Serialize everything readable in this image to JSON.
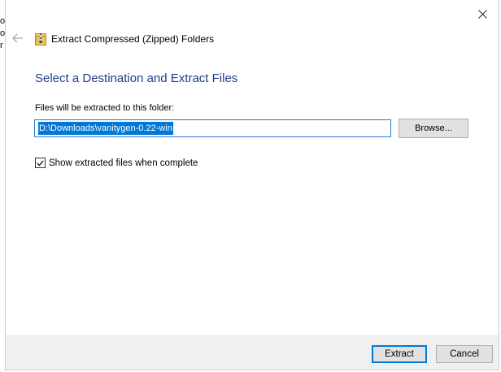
{
  "dialog": {
    "title": "Extract Compressed (Zipped) Folders",
    "heading": "Select a Destination and Extract Files",
    "destination_label": "Files will be extracted to this folder:",
    "destination_value": "D:\\Downloads\\vanitygen-0.22-win",
    "browse_label": "Browse...",
    "show_files_label": "Show extracted files when complete",
    "show_files_checked": true,
    "extract_label": "Extract",
    "cancel_label": "Cancel"
  },
  "background_sliver": {
    "chars": [
      "o",
      "o",
      "r"
    ]
  },
  "colors": {
    "heading": "#1b3f8b",
    "accent": "#0078d7",
    "footer": "#f0f0f0",
    "button": "#e1e1e1"
  },
  "icons": {
    "close": "close-icon",
    "back": "back-arrow-icon",
    "zip": "zipped-folder-icon",
    "check": "checkmark-icon"
  }
}
